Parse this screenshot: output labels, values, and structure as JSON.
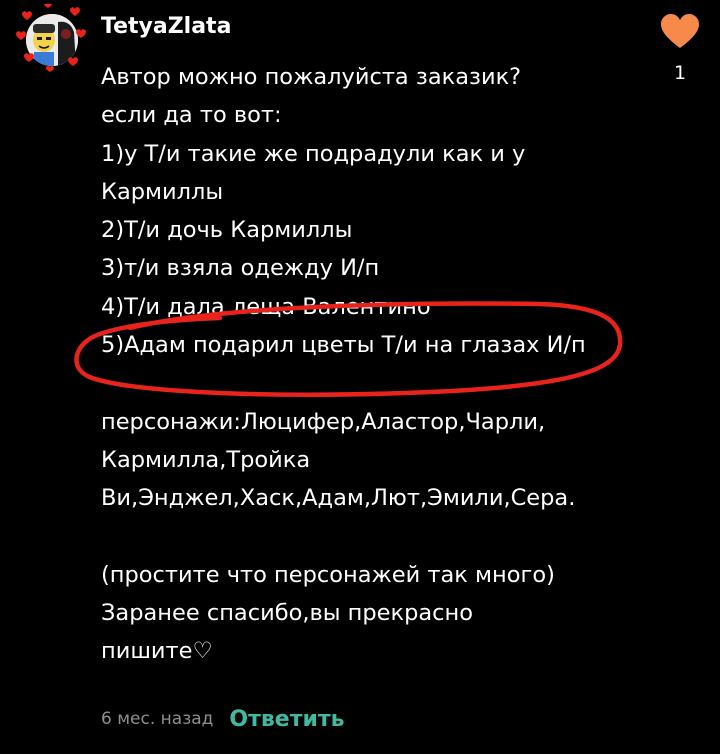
{
  "comment": {
    "author": "TetyaZlata",
    "like_count": "1",
    "lines": [
      "Автор можно пожалуйста заказик?",
      "если да то вот:",
      "1)у Т/и такие же подрадули как и у",
      "Кармиллы",
      "2)Т/и дочь Кармиллы",
      "3)т/и взяла одежду И/п",
      "4)Т/и дала леща Валентино",
      "5)Адам подарил цветы Т/и на глазах И/п",
      "",
      "персонажи:Люцифер,Аластор,Чарли,",
      "Кармилла,Тройка",
      "Ви,Энджел,Хаск,Адам,Лют,Эмили,Сера.",
      "",
      "(простите что персонажей так много)",
      "Заранее спасибо,вы прекрасно",
      "пишите♡"
    ],
    "timestamp": "6 мес. назад",
    "reply_label": "Ответить"
  },
  "icons": {
    "like": "heart-icon",
    "avatar_frame": "heart-frame-decoration"
  },
  "colors": {
    "background": "#000000",
    "text": "#ffffff",
    "like_heart": "#f58a4b",
    "reply_accent": "#3fb9a2",
    "timestamp": "#8e8e8e",
    "highlight_stroke": "#e8231b",
    "avatar_hearts": "#e8231b"
  }
}
